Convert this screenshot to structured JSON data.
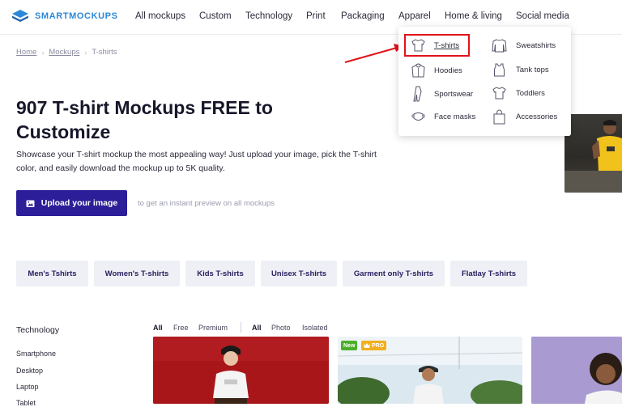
{
  "brand": {
    "name": "SMARTMOCKUPS",
    "color": "#2b88d8",
    "accent": "#2c1e98",
    "highlight": "#e0131a"
  },
  "nav": {
    "items": [
      {
        "label": "All mockups"
      },
      {
        "label": "Custom"
      },
      {
        "label": "Technology"
      },
      {
        "label": "Print"
      },
      {
        "label": "Packaging"
      },
      {
        "label": "Apparel"
      },
      {
        "label": "Home & living"
      },
      {
        "label": "Social media"
      }
    ]
  },
  "breadcrumb": {
    "home": "Home",
    "mockups": "Mockups",
    "current": "T-shirts",
    "separator": "›"
  },
  "hero": {
    "title": "907 T-shirt Mockups FREE to Customize",
    "description": "Showcase your T-shirt mockup the most appealing way! Just upload your image, pick the T-shirt color, and easily download the mockup up to 5K quality.",
    "upload_label": "Upload your image",
    "upload_hint": "to get an instant preview on all mockups"
  },
  "dropdown": {
    "items": [
      {
        "label": "T-shirts",
        "icon": "tshirt-icon"
      },
      {
        "label": "Sweatshirts",
        "icon": "sweatshirt-icon"
      },
      {
        "label": "Hoodies",
        "icon": "hoodie-icon"
      },
      {
        "label": "Tank tops",
        "icon": "tank-top-icon"
      },
      {
        "label": "Sportswear",
        "icon": "sportswear-icon"
      },
      {
        "label": "Toddlers",
        "icon": "toddler-shirt-icon"
      },
      {
        "label": "Face masks",
        "icon": "face-mask-icon"
      },
      {
        "label": "Accessories",
        "icon": "tote-bag-icon"
      }
    ]
  },
  "chips": [
    {
      "label": "Men's Tshirts"
    },
    {
      "label": "Women's T-shirts"
    },
    {
      "label": "Kids T-shirts"
    },
    {
      "label": "Unisex T-shirts"
    },
    {
      "label": "Garment only T-shirts"
    },
    {
      "label": "Flatlay T-shirts"
    }
  ],
  "sidebar": {
    "heading": "Technology",
    "items": [
      {
        "label": "Smartphone"
      },
      {
        "label": "Desktop"
      },
      {
        "label": "Laptop"
      },
      {
        "label": "Tablet"
      }
    ]
  },
  "filters": {
    "pricing": [
      {
        "label": "All"
      },
      {
        "label": "Free"
      },
      {
        "label": "Premium"
      }
    ],
    "type": [
      {
        "label": "All"
      },
      {
        "label": "Photo"
      },
      {
        "label": "Isolated"
      }
    ]
  },
  "cards": {
    "badge_new": "New",
    "badge_pro": "PRO",
    "badge_new_color": "#4caf2a",
    "badge_pro_color": "#f2b01e"
  }
}
